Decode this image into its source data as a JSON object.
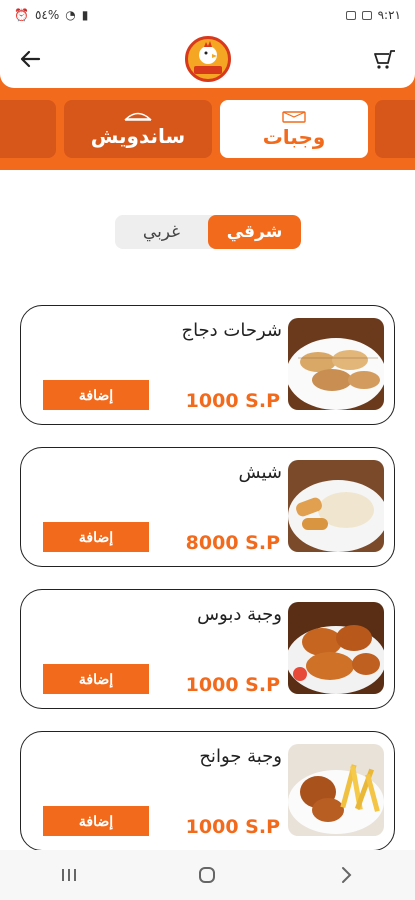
{
  "status_bar": {
    "time": "٩:٢١",
    "battery": "٥٤%"
  },
  "tabs": [
    {
      "label": "وجبات",
      "icon": "meal-box-icon",
      "active": true
    },
    {
      "label": "ساندويش",
      "icon": "sandwich-icon",
      "active": false
    }
  ],
  "filter": {
    "selected": "شرقي",
    "other": "غربي"
  },
  "items": [
    {
      "name": "شرحات دجاج",
      "price": "1000 S.P",
      "add_label": "إضافة",
      "image": "grilled-chicken-slices-image"
    },
    {
      "name": "شيش",
      "price": "8000 S.P",
      "add_label": "إضافة",
      "image": "shish-with-rice-image"
    },
    {
      "name": "وجبة دبوس",
      "price": "1000 S.P",
      "add_label": "إضافة",
      "image": "fried-drumsticks-image"
    },
    {
      "name": "وجبة جوانح",
      "price": "1000 S.P",
      "add_label": "إضافة",
      "image": "wings-with-fries-image"
    }
  ],
  "colors": {
    "accent": "#f26b1d",
    "accent_dark": "#d7561a"
  }
}
